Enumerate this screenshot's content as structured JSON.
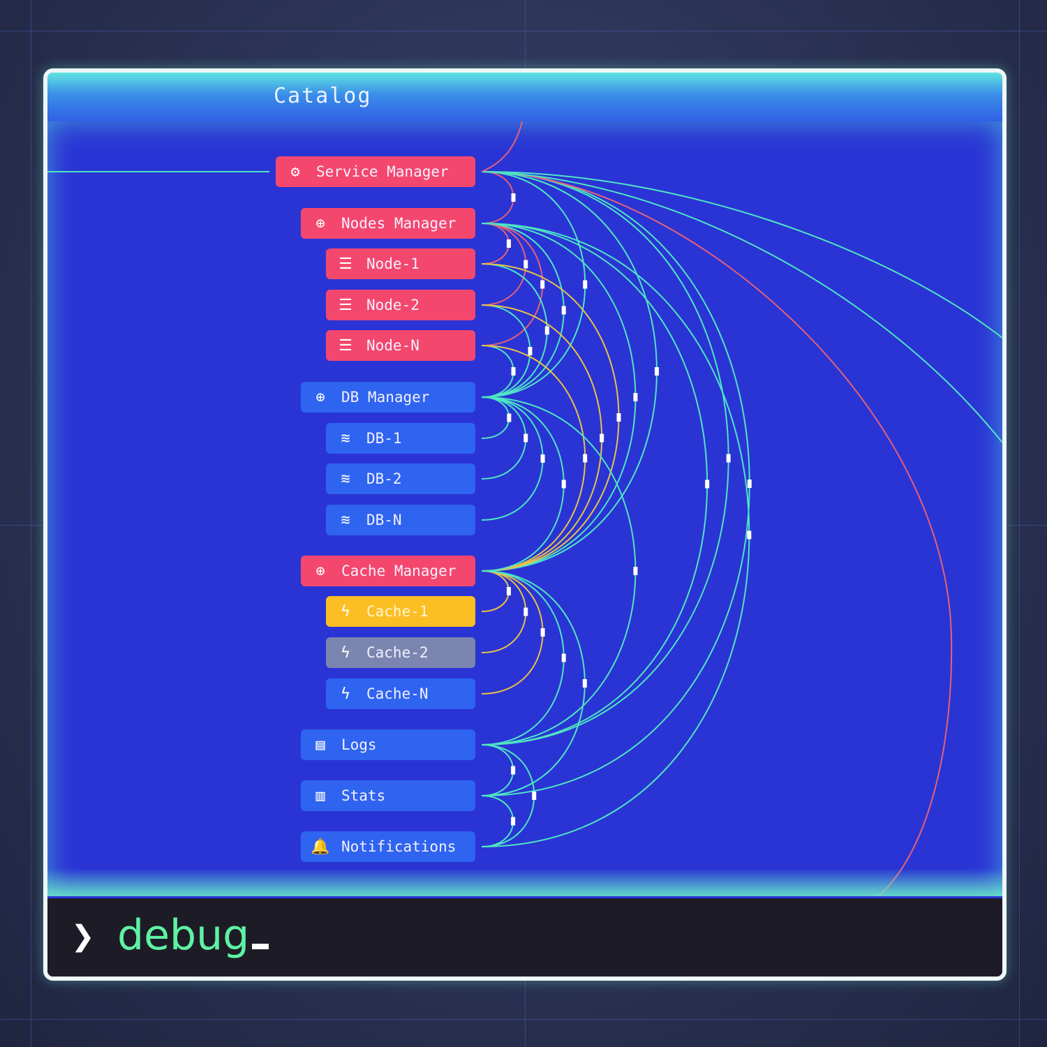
{
  "header": {
    "title": "Catalog"
  },
  "terminal": {
    "prompt": "❯",
    "command": "debug"
  },
  "colors": {
    "red": "#f4476e",
    "blue": "#2f64f0",
    "yellow": "#fbbf24",
    "gray": "#7b86b0",
    "edge_cyan": "#4ee6c4",
    "edge_red": "#e5607a",
    "edge_yellow": "#e8c24a"
  },
  "nodes": [
    {
      "id": "service",
      "label": "Service Manager",
      "icon": "gear-icon",
      "color": "red"
    },
    {
      "id": "nodes",
      "label": "Nodes Manager",
      "icon": "hub-icon",
      "color": "red"
    },
    {
      "id": "node1",
      "label": "Node-1",
      "icon": "server-icon",
      "color": "red"
    },
    {
      "id": "node2",
      "label": "Node-2",
      "icon": "server-icon",
      "color": "red"
    },
    {
      "id": "nodeN",
      "label": "Node-N",
      "icon": "server-icon",
      "color": "red"
    },
    {
      "id": "db",
      "label": "DB Manager",
      "icon": "hub-icon",
      "color": "blue"
    },
    {
      "id": "db1",
      "label": "DB-1",
      "icon": "database-icon",
      "color": "blue"
    },
    {
      "id": "db2",
      "label": "DB-2",
      "icon": "database-icon",
      "color": "blue"
    },
    {
      "id": "dbN",
      "label": "DB-N",
      "icon": "database-icon",
      "color": "blue"
    },
    {
      "id": "cache",
      "label": "Cache Manager",
      "icon": "hub-icon",
      "color": "red"
    },
    {
      "id": "cache1",
      "label": "Cache-1",
      "icon": "bolt-icon",
      "color": "yellow"
    },
    {
      "id": "cache2",
      "label": "Cache-2",
      "icon": "bolt-icon",
      "color": "gray"
    },
    {
      "id": "cacheN",
      "label": "Cache-N",
      "icon": "bolt-icon",
      "color": "blue"
    },
    {
      "id": "logs",
      "label": "Logs",
      "icon": "document-icon",
      "color": "blue"
    },
    {
      "id": "stats",
      "label": "Stats",
      "icon": "stats-icon",
      "color": "blue"
    },
    {
      "id": "notif",
      "label": "Notifications",
      "icon": "bell-icon",
      "color": "blue"
    }
  ],
  "edges": [
    [
      "service",
      "nodes",
      "red"
    ],
    [
      "nodes",
      "node1",
      "red"
    ],
    [
      "nodes",
      "node2",
      "red"
    ],
    [
      "nodes",
      "nodeN",
      "red"
    ],
    [
      "service",
      "db",
      "cyan"
    ],
    [
      "service",
      "cache",
      "cyan"
    ],
    [
      "service",
      "logs",
      "cyan"
    ],
    [
      "service",
      "stats",
      "cyan"
    ],
    [
      "nodes",
      "db",
      "cyan"
    ],
    [
      "nodes",
      "cache",
      "cyan"
    ],
    [
      "nodes",
      "logs",
      "cyan"
    ],
    [
      "nodes",
      "notif",
      "cyan"
    ],
    [
      "node1",
      "db",
      "cyan"
    ],
    [
      "node2",
      "db",
      "cyan"
    ],
    [
      "nodeN",
      "db",
      "cyan"
    ],
    [
      "node1",
      "cache",
      "yellow"
    ],
    [
      "node2",
      "cache",
      "yellow"
    ],
    [
      "nodeN",
      "cache",
      "yellow"
    ],
    [
      "db",
      "db1",
      "cyan"
    ],
    [
      "db",
      "db2",
      "cyan"
    ],
    [
      "db",
      "dbN",
      "cyan"
    ],
    [
      "db",
      "cache",
      "cyan"
    ],
    [
      "db",
      "logs",
      "cyan"
    ],
    [
      "cache",
      "cache1",
      "yellow"
    ],
    [
      "cache",
      "cache2",
      "yellow"
    ],
    [
      "cache",
      "cacheN",
      "yellow"
    ],
    [
      "cache",
      "logs",
      "cyan"
    ],
    [
      "cache",
      "stats",
      "cyan"
    ],
    [
      "logs",
      "stats",
      "cyan"
    ],
    [
      "logs",
      "notif",
      "cyan"
    ],
    [
      "stats",
      "notif",
      "cyan"
    ]
  ]
}
